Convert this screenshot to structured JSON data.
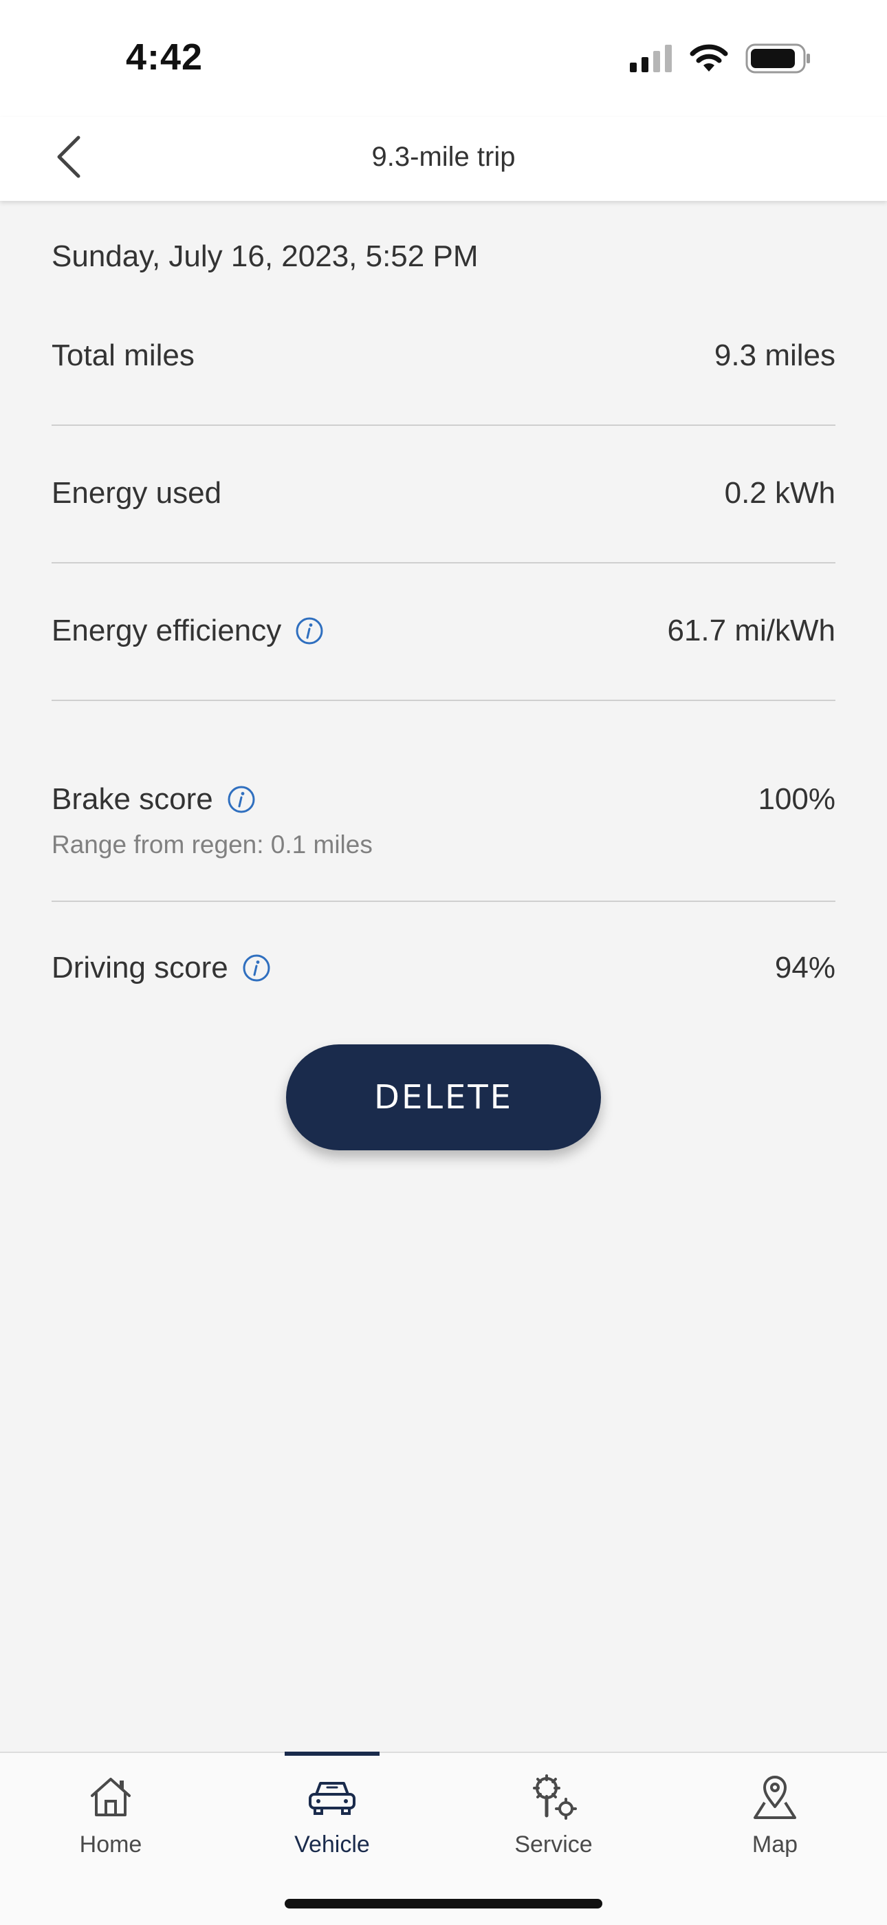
{
  "status_bar": {
    "time": "4:42"
  },
  "header": {
    "title": "9.3-mile trip"
  },
  "trip": {
    "date": "Sunday, July 16, 2023, 5:52 PM",
    "total_miles": {
      "label": "Total miles",
      "value": "9.3 miles"
    },
    "energy_used": {
      "label": "Energy used",
      "value": "0.2 kWh"
    },
    "energy_efficiency": {
      "label": "Energy efficiency",
      "value": "61.7 mi/kWh"
    },
    "brake_score": {
      "label": "Brake score",
      "value": "100%",
      "sub": "Range from regen: 0.1 miles"
    },
    "driving_score": {
      "label": "Driving score",
      "value": "94%"
    }
  },
  "actions": {
    "delete_label": "DELETE"
  },
  "tab_bar": {
    "items": [
      {
        "label": "Home",
        "icon": "home-icon",
        "active": false
      },
      {
        "label": "Vehicle",
        "icon": "car-icon",
        "active": true
      },
      {
        "label": "Service",
        "icon": "service-icon",
        "active": false
      },
      {
        "label": "Map",
        "icon": "map-pin-icon",
        "active": false
      }
    ]
  },
  "colors": {
    "accent": "#1a2b4c",
    "info": "#2f6fbf",
    "background": "#f4f4f4"
  }
}
